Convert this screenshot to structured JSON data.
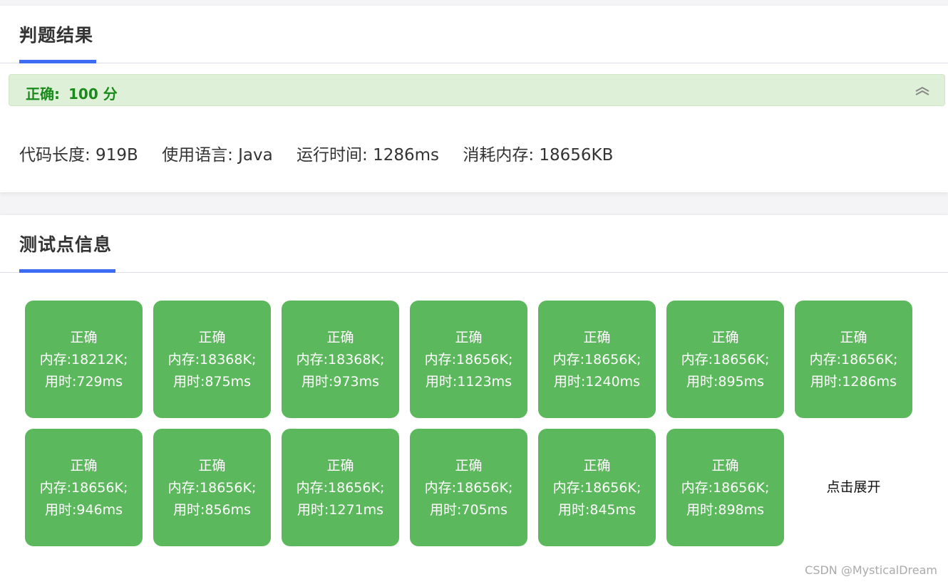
{
  "result": {
    "title": "判题结果",
    "verdict_label": "正确:",
    "verdict_score": "100 分",
    "meta": [
      "代码长度: 919B",
      "使用语言: Java",
      "运行时间: 1286ms",
      "消耗内存: 18656KB"
    ]
  },
  "tests": {
    "title": "测试点信息",
    "expand_label": "点击展开",
    "items": [
      {
        "status": "正确",
        "memory": "内存:18212K;",
        "time": "用时:729ms"
      },
      {
        "status": "正确",
        "memory": "内存:18368K;",
        "time": "用时:875ms"
      },
      {
        "status": "正确",
        "memory": "内存:18368K;",
        "time": "用时:973ms"
      },
      {
        "status": "正确",
        "memory": "内存:18656K;",
        "time": "用时:1123ms"
      },
      {
        "status": "正确",
        "memory": "内存:18656K;",
        "time": "用时:1240ms"
      },
      {
        "status": "正确",
        "memory": "内存:18656K;",
        "time": "用时:895ms"
      },
      {
        "status": "正确",
        "memory": "内存:18656K;",
        "time": "用时:1286ms"
      },
      {
        "status": "正确",
        "memory": "内存:18656K;",
        "time": "用时:946ms"
      },
      {
        "status": "正确",
        "memory": "内存:18656K;",
        "time": "用时:856ms"
      },
      {
        "status": "正确",
        "memory": "内存:18656K;",
        "time": "用时:1271ms"
      },
      {
        "status": "正确",
        "memory": "内存:18656K;",
        "time": "用时:705ms"
      },
      {
        "status": "正确",
        "memory": "内存:18656K;",
        "time": "用时:845ms"
      },
      {
        "status": "正确",
        "memory": "内存:18656K;",
        "time": "用时:898ms"
      }
    ]
  },
  "watermark": "CSDN @MysticalDream",
  "colors": {
    "accent": "#3b6cf1",
    "pass_green": "#5cb85c",
    "verdict_bg": "#dff0d8",
    "verdict_text": "#1a8a1a"
  },
  "icons": {
    "collapse": "double-chevron-up-icon"
  }
}
